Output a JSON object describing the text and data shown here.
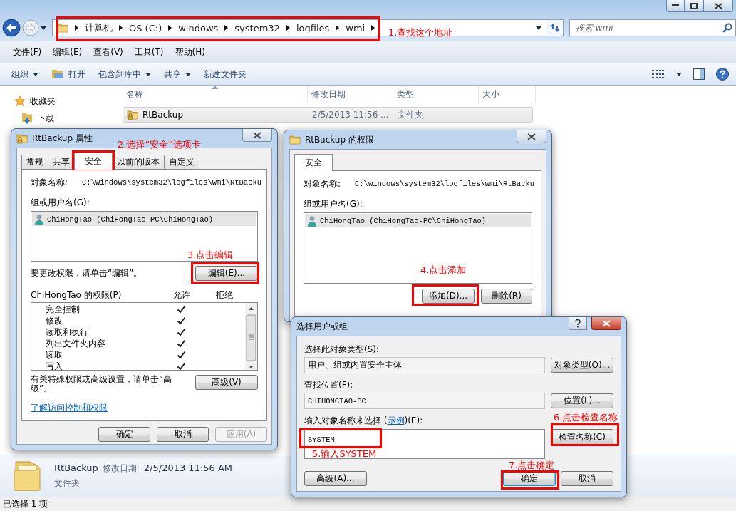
{
  "explorer": {
    "address": {
      "crumbs": [
        "计算机",
        "OS (C:)",
        "windows",
        "system32",
        "logfiles",
        "wmi"
      ]
    },
    "search": {
      "placeholder": "搜索 wmi"
    },
    "menu": [
      "文件(F)",
      "编辑(E)",
      "查看(V)",
      "工具(T)",
      "帮助(H)"
    ],
    "toolbar": [
      {
        "label": "组织",
        "kind": "dropdown"
      },
      {
        "label": "打开",
        "kind": "icon"
      },
      {
        "label": "包含到库中",
        "kind": "dropdown"
      },
      {
        "label": "共享",
        "kind": "dropdown"
      },
      {
        "label": "新建文件夹",
        "kind": "plain"
      }
    ],
    "nav": [
      {
        "label": "收藏夹",
        "kind": "star"
      },
      {
        "label": "下载",
        "kind": "download"
      }
    ],
    "columns": [
      "名称",
      "修改日期",
      "类型",
      "大小"
    ],
    "files": [
      {
        "name": "RtBackup",
        "date": "2/5/2013 11:56 ...",
        "type": "文件夹",
        "selected": true
      }
    ],
    "details": {
      "name": "RtBackup",
      "date_label": "修改日期:",
      "date": "2/5/2013 11:56 AM",
      "type": "文件夹"
    },
    "status_bar": "已选择 1 项"
  },
  "properties_dialog": {
    "title": "RtBackup 属性",
    "tabs": [
      {
        "label": "常规",
        "selected": false
      },
      {
        "label": "共享",
        "selected": false
      },
      {
        "label": "安全",
        "selected": true
      },
      {
        "label": "以前的版本",
        "selected": false
      },
      {
        "label": "自定义",
        "selected": false
      }
    ],
    "object_label": "对象名称:",
    "object_value": "C:\\windows\\system32\\logfiles\\wmi\\RtBacku",
    "group_label": "组或用户名(G):",
    "users": [
      {
        "name": "ChiHongTao (ChiHongTao-PC\\ChiHongTao)",
        "selected": true
      }
    ],
    "change_hint": "要更改权限，请单击“编辑”。",
    "edit_button": "编辑(E)...",
    "perm_label": "ChiHongTao 的权限(P)",
    "allow_header": "允许",
    "deny_header": "拒绝",
    "permissions": [
      {
        "name": "完全控制",
        "allow": true
      },
      {
        "name": "修改",
        "allow": true
      },
      {
        "name": "读取和执行",
        "allow": true
      },
      {
        "name": "列出文件夹内容",
        "allow": true
      },
      {
        "name": "读取",
        "allow": true
      },
      {
        "name": "写入",
        "allow": true
      }
    ],
    "advanced_hint": "有关特殊权限或高级设置，请单击“高级”。",
    "advanced_button": "高级(V)",
    "link": "了解访问控制和权限",
    "buttons": [
      {
        "label": "确定",
        "disabled": false
      },
      {
        "label": "取消",
        "disabled": false
      },
      {
        "label": "应用(A)",
        "disabled": true
      }
    ]
  },
  "permissions_dialog": {
    "title": "RtBackup 的权限",
    "tabs": [
      {
        "label": "安全",
        "selected": true
      }
    ],
    "object_label": "对象名称:",
    "object_value": "C:\\windows\\system32\\logfiles\\wmi\\RtBacku",
    "group_label": "组或用户名(G):",
    "users": [
      {
        "name": "ChiHongTao (ChiHongTao-PC\\ChiHongTao)",
        "selected": true
      }
    ],
    "buttons": [
      "添加(D)...",
      "删除(R)"
    ]
  },
  "select_dialog": {
    "title": "选择用户或组",
    "type_label": "选择此对象类型(S):",
    "type_value": "用户、组或内置安全主体",
    "type_button": "对象类型(O)...",
    "location_label": "查找位置(F):",
    "location_value": "CHIHONGTAO-PC",
    "location_button": "位置(L)...",
    "names_label": {
      "before": "输入对象名称来选择 (",
      "link": "示例",
      "after": ")(E):"
    },
    "names_value": "SYSTEM",
    "check_button": "检查名称(C)",
    "advanced_button": "高级(A)...",
    "buttons": [
      {
        "label": "确定",
        "default": true
      },
      {
        "label": "取消",
        "default": false
      }
    ]
  },
  "annotations": [
    "1.查找这个地址",
    "2.选择“安全”选项卡",
    "3.点击编辑",
    "4.点击添加",
    "5.输入SYSTEM",
    "6.点击检查名称",
    "7.点击确定"
  ]
}
